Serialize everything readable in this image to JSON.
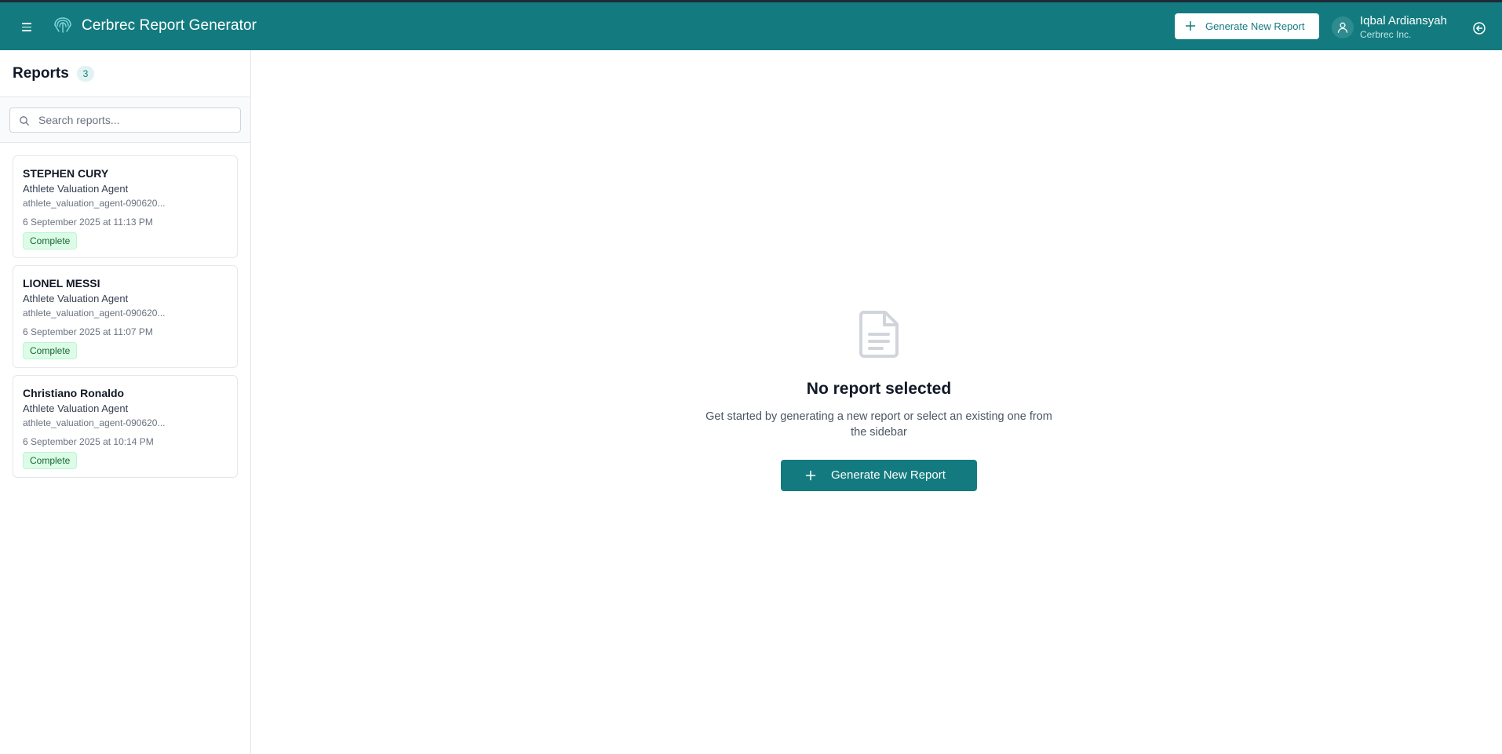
{
  "app": {
    "title": "Cerbrec Report Generator",
    "brand_color": "#137b7f",
    "icons": {
      "menu": "menu-icon",
      "logo": "brain-icon",
      "logout": "logout-icon",
      "user": "user-icon",
      "search": "search-icon",
      "plus": "plus-icon",
      "document": "document-icon"
    }
  },
  "header": {
    "generate_button_label": "Generate New Report",
    "user_name": "Iqbal Ardiansyah",
    "user_org": "Cerbrec Inc."
  },
  "sidebar": {
    "title": "Reports",
    "count": "3",
    "search_placeholder": "Search reports...",
    "reports": [
      {
        "name": "STEPHEN CURY",
        "agent": "Athlete Valuation Agent",
        "id": "athlete_valuation_agent-090620...",
        "date": "6 September 2025 at 11:13 PM",
        "status": "Complete"
      },
      {
        "name": "LIONEL MESSI",
        "agent": "Athlete Valuation Agent",
        "id": "athlete_valuation_agent-090620...",
        "date": "6 September 2025 at 11:07 PM",
        "status": "Complete"
      },
      {
        "name": "Christiano Ronaldo",
        "agent": "Athlete Valuation Agent",
        "id": "athlete_valuation_agent-090620...",
        "date": "6 September 2025 at 10:14 PM",
        "status": "Complete"
      }
    ]
  },
  "main": {
    "empty_title": "No report selected",
    "empty_description": "Get started by generating a new report or select an existing one from the sidebar",
    "generate_button_label": "Generate New Report"
  }
}
